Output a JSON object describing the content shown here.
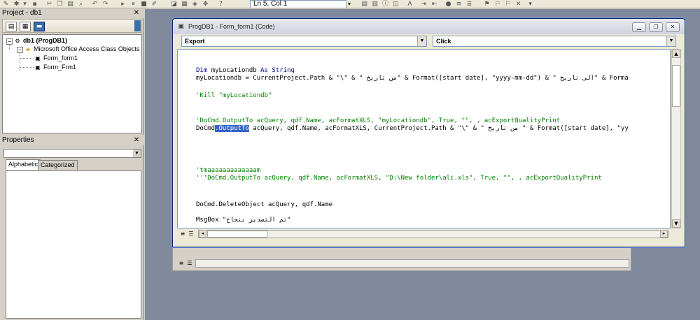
{
  "toolbar": {
    "position_readout": "Ln 5, Col 1"
  },
  "project_pane": {
    "title": "Project - db1",
    "tree": {
      "root": "db1 (ProgDB1)",
      "folder": "Microsoft Office Access Class Objects",
      "items": [
        "Form_form1",
        "Form_Frm1"
      ]
    }
  },
  "properties_pane": {
    "title": "Properties",
    "tabs": [
      "Alphabetic",
      "Categorized"
    ]
  },
  "code_window": {
    "title": "ProgDB1 - Form_form1 (Code)",
    "object_combo": "Export",
    "procedure_combo": "Click",
    "lines": [
      {
        "text": "Dim myLocationdb As String",
        "type": "code"
      },
      {
        "text": "myLocationdb = CurrentProject.Path & \"\\\" & \" من تاريخ\" & Format([start date], \"yyyy-mm-dd\") & \" الى تاريخ\" & Forma",
        "type": "code"
      },
      {
        "text": "'Kill \"myLocationdb\"",
        "type": "comment"
      },
      {
        "text": "'DoCmd.OutputTo acQuery, qdf.Name, acFormatXLS, \"myLocationdb\", True, \"\", , acExportQualityPrint",
        "type": "comment"
      },
      {
        "text_before": "DoCmd",
        "text_highlight": ".OutputTo",
        "text_after": " acQuery, qdf.Name, acFormatXLS, CurrentProject.Path & \"\\\" & \" من تاريخ \" & Format([start date], \"yy",
        "type": "code"
      },
      {
        "text": "'tmaaaaaaaaaaaaam",
        "type": "comment"
      },
      {
        "text": "'''DoCmd.OutputTo acQuery, qdf.Name, acFormatXLS, \"D:\\New folder\\ali.xls\", True, \"\", , acExportQualityPrint",
        "type": "comment"
      },
      {
        "text": "DoCmd.DeleteObject acQuery, qdf.Name",
        "type": "code"
      },
      {
        "text": "MsgBox \"تم التصدير بنجاح\"",
        "type": "code"
      }
    ]
  }
}
